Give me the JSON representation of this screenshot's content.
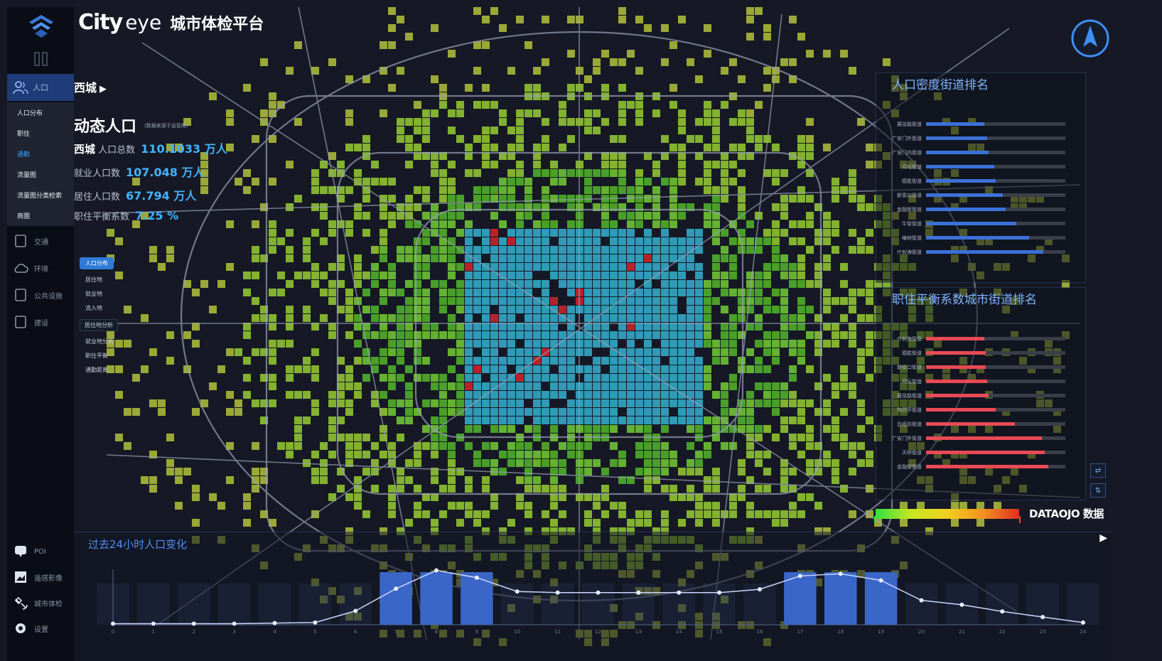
{
  "app": {
    "brand_city": "City",
    "brand_eye": "eye",
    "brand_cn": "城市体检平台"
  },
  "sidebar": {
    "active": {
      "icon": "people-icon",
      "label": "人口"
    },
    "subitems": [
      {
        "label": "人口分布",
        "selected": false
      },
      {
        "label": "职住",
        "selected": false
      },
      {
        "label": "通勤",
        "selected": true
      },
      {
        "label": "流量图",
        "selected": false
      },
      {
        "label": "流量图分类检索",
        "selected": false
      },
      {
        "label": "商圈",
        "selected": false
      }
    ],
    "items": [
      {
        "icon": "building-icon",
        "label": "交通"
      },
      {
        "icon": "cloud-icon",
        "label": "环境"
      },
      {
        "icon": "calendar-icon",
        "label": "公共设施"
      },
      {
        "icon": "document-icon",
        "label": "建设"
      }
    ],
    "bottom_items": [
      {
        "icon": "poi-icon",
        "label": "POI"
      },
      {
        "icon": "image-icon",
        "label": "遥感影像"
      },
      {
        "icon": "satellite-icon",
        "label": "城市体检"
      },
      {
        "icon": "gear-icon",
        "label": "设置"
      }
    ]
  },
  "district": {
    "name": "西城",
    "arrow": "▶"
  },
  "section": {
    "title": "动态人口",
    "note": "(数据来源于运营商)",
    "district_label": "西城",
    "stats": [
      {
        "label": "人口总数",
        "value": "110.1033 万人"
      },
      {
        "label": "就业人口数",
        "value": "107.048 万人"
      },
      {
        "label": "居住人口数",
        "value": "67.794 万人"
      },
      {
        "label": "职住平衡系数",
        "value": "7.25 %"
      }
    ]
  },
  "layers": {
    "chip": "人口分布",
    "options": [
      "居住地",
      "就业地",
      "流入地"
    ],
    "mode_chip": "居住地分析",
    "extra": [
      "就业地分析",
      "职住平衡",
      "通勤距离"
    ]
  },
  "panels": {
    "density": {
      "title": "人口密度街道排名",
      "color": "#3b72d9",
      "rows": [
        {
          "name": "展览路街道",
          "pct": 0.42
        },
        {
          "name": "广安门外街道",
          "pct": 0.44
        },
        {
          "name": "广安门内街道",
          "pct": 0.45
        },
        {
          "name": "月坛街道",
          "pct": 0.49
        },
        {
          "name": "德胜街道",
          "pct": 0.5
        },
        {
          "name": "新街口街道",
          "pct": 0.55
        },
        {
          "name": "金融街街道",
          "pct": 0.57
        },
        {
          "name": "牛街街道",
          "pct": 0.65
        },
        {
          "name": "椿树街道",
          "pct": 0.74
        },
        {
          "name": "什刹海街道",
          "pct": 0.84
        }
      ]
    },
    "balance": {
      "title": "职住平衡系数城市街道排名",
      "color": "#e94a55",
      "rows": [
        {
          "name": "什刹海街道",
          "pct": 0.42
        },
        {
          "name": "德胜街道",
          "pct": 0.43
        },
        {
          "name": "新街口街道",
          "pct": 0.43
        },
        {
          "name": "月坛街道",
          "pct": 0.44
        },
        {
          "name": "展览路街道",
          "pct": 0.45
        },
        {
          "name": "陶然亭街道",
          "pct": 0.5
        },
        {
          "name": "白纸坊街道",
          "pct": 0.64
        },
        {
          "name": "广安门外街道",
          "pct": 0.83
        },
        {
          "name": "天桥街道",
          "pct": 0.85
        },
        {
          "name": "金融街街道",
          "pct": 0.88
        }
      ]
    }
  },
  "legend": {
    "colors": [
      "#30e040",
      "#c8e820",
      "#f2d020",
      "#f29020",
      "#e0301e"
    ]
  },
  "logo_text": "DATAOJO 数据",
  "controls": [
    "⇄",
    "⇅"
  ],
  "trend": {
    "title": "过去24小时人口变化",
    "play": "▶",
    "chart_data": {
      "type": "bar",
      "title": "过去24小时人口变化",
      "categories": [
        "0",
        "1",
        "2",
        "3",
        "4",
        "5",
        "6",
        "7",
        "8",
        "9",
        "10",
        "11",
        "12",
        "13",
        "14",
        "15",
        "16",
        "17",
        "18",
        "19",
        "20",
        "21",
        "22",
        "23",
        "24"
      ],
      "bar_values": [
        0,
        0,
        0,
        0,
        0,
        0,
        0,
        1,
        1,
        1,
        0,
        0,
        0,
        0,
        0,
        0,
        0,
        1,
        1,
        1,
        0,
        0,
        0,
        0,
        0
      ],
      "line_values": [
        0.02,
        0.02,
        0.02,
        0.02,
        0.03,
        0.04,
        0.25,
        0.65,
        0.98,
        0.85,
        0.6,
        0.58,
        0.58,
        0.58,
        0.58,
        0.58,
        0.64,
        0.88,
        0.92,
        0.8,
        0.44,
        0.36,
        0.24,
        0.14,
        0.04
      ],
      "ylim": [
        0,
        1
      ]
    }
  }
}
